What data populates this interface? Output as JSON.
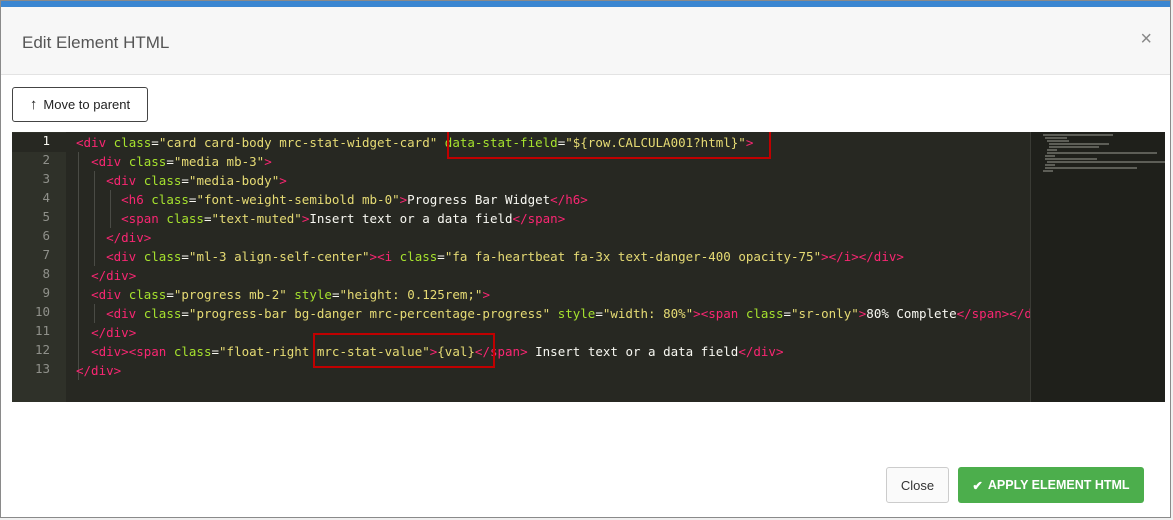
{
  "dialog": {
    "title": "Edit Element HTML",
    "close_symbol": "×"
  },
  "toolbar": {
    "move_to_parent_label": "Move to parent",
    "move_icon": "arrow-up-icon"
  },
  "editor": {
    "line_numbers": [
      "1",
      "2",
      "3",
      "4",
      "5",
      "6",
      "7",
      "8",
      "9",
      "10",
      "11",
      "12",
      "13"
    ],
    "active_line": 1
  },
  "footer": {
    "close_label": "Close",
    "apply_label": "APPLY ELEMENT HTML",
    "apply_icon": "checkmark-icon"
  },
  "colors": {
    "accent_bar": "#3b86d1",
    "apply_green": "#4cae4c",
    "highlight_red": "#c00000",
    "editor_bg": "#272822"
  }
}
